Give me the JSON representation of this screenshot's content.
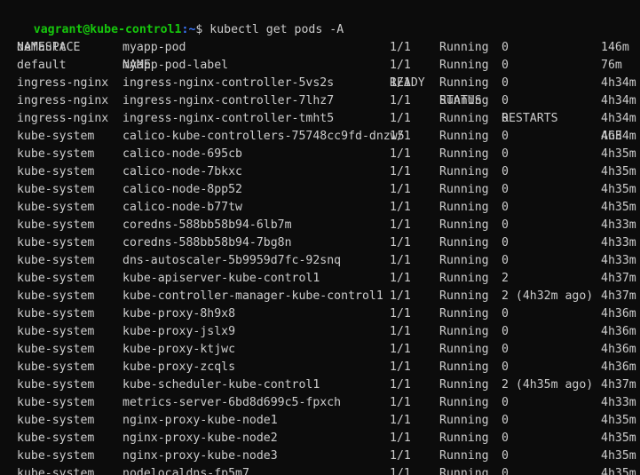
{
  "window": {
    "partial_line": "",
    "prompt_user_host": "vagrant@kube-control1",
    "prompt_path": ":~",
    "prompt_symbol": "$ ",
    "command": "kubectl get pods -A"
  },
  "table": {
    "headers": {
      "namespace": "NAMESPACE",
      "name": "NAME",
      "ready": "READY",
      "status": "STATUS",
      "restarts": "RESTARTS",
      "age": "AGE"
    },
    "rows": [
      {
        "namespace": "default",
        "name": "myapp-pod",
        "ready": "1/1",
        "status": "Running",
        "restarts": "0",
        "age": "146m"
      },
      {
        "namespace": "default",
        "name": "myapp-pod-label",
        "ready": "1/1",
        "status": "Running",
        "restarts": "0",
        "age": "76m"
      },
      {
        "namespace": "ingress-nginx",
        "name": "ingress-nginx-controller-5vs2s",
        "ready": "1/1",
        "status": "Running",
        "restarts": "0",
        "age": "4h34m"
      },
      {
        "namespace": "ingress-nginx",
        "name": "ingress-nginx-controller-7lhz7",
        "ready": "1/1",
        "status": "Running",
        "restarts": "0",
        "age": "4h34m"
      },
      {
        "namespace": "ingress-nginx",
        "name": "ingress-nginx-controller-tmht5",
        "ready": "1/1",
        "status": "Running",
        "restarts": "0",
        "age": "4h34m"
      },
      {
        "namespace": "kube-system",
        "name": "calico-kube-controllers-75748cc9fd-dnzw5",
        "ready": "1/1",
        "status": "Running",
        "restarts": "0",
        "age": "4h34m"
      },
      {
        "namespace": "kube-system",
        "name": "calico-node-695cb",
        "ready": "1/1",
        "status": "Running",
        "restarts": "0",
        "age": "4h35m"
      },
      {
        "namespace": "kube-system",
        "name": "calico-node-7bkxc",
        "ready": "1/1",
        "status": "Running",
        "restarts": "0",
        "age": "4h35m"
      },
      {
        "namespace": "kube-system",
        "name": "calico-node-8pp52",
        "ready": "1/1",
        "status": "Running",
        "restarts": "0",
        "age": "4h35m"
      },
      {
        "namespace": "kube-system",
        "name": "calico-node-b77tw",
        "ready": "1/1",
        "status": "Running",
        "restarts": "0",
        "age": "4h35m"
      },
      {
        "namespace": "kube-system",
        "name": "coredns-588bb58b94-6lb7m",
        "ready": "1/1",
        "status": "Running",
        "restarts": "0",
        "age": "4h33m"
      },
      {
        "namespace": "kube-system",
        "name": "coredns-588bb58b94-7bg8n",
        "ready": "1/1",
        "status": "Running",
        "restarts": "0",
        "age": "4h33m"
      },
      {
        "namespace": "kube-system",
        "name": "dns-autoscaler-5b9959d7fc-92snq",
        "ready": "1/1",
        "status": "Running",
        "restarts": "0",
        "age": "4h33m"
      },
      {
        "namespace": "kube-system",
        "name": "kube-apiserver-kube-control1",
        "ready": "1/1",
        "status": "Running",
        "restarts": "2",
        "age": "4h37m"
      },
      {
        "namespace": "kube-system",
        "name": "kube-controller-manager-kube-control1",
        "ready": "1/1",
        "status": "Running",
        "restarts": "2 (4h32m ago)",
        "age": "4h37m"
      },
      {
        "namespace": "kube-system",
        "name": "kube-proxy-8h9x8",
        "ready": "1/1",
        "status": "Running",
        "restarts": "0",
        "age": "4h36m"
      },
      {
        "namespace": "kube-system",
        "name": "kube-proxy-jslx9",
        "ready": "1/1",
        "status": "Running",
        "restarts": "0",
        "age": "4h36m"
      },
      {
        "namespace": "kube-system",
        "name": "kube-proxy-ktjwc",
        "ready": "1/1",
        "status": "Running",
        "restarts": "0",
        "age": "4h36m"
      },
      {
        "namespace": "kube-system",
        "name": "kube-proxy-zcqls",
        "ready": "1/1",
        "status": "Running",
        "restarts": "0",
        "age": "4h36m"
      },
      {
        "namespace": "kube-system",
        "name": "kube-scheduler-kube-control1",
        "ready": "1/1",
        "status": "Running",
        "restarts": "2 (4h35m ago)",
        "age": "4h37m"
      },
      {
        "namespace": "kube-system",
        "name": "metrics-server-6bd8d699c5-fpxch",
        "ready": "1/1",
        "status": "Running",
        "restarts": "0",
        "age": "4h33m"
      },
      {
        "namespace": "kube-system",
        "name": "nginx-proxy-kube-node1",
        "ready": "1/1",
        "status": "Running",
        "restarts": "0",
        "age": "4h35m"
      },
      {
        "namespace": "kube-system",
        "name": "nginx-proxy-kube-node2",
        "ready": "1/1",
        "status": "Running",
        "restarts": "0",
        "age": "4h35m"
      },
      {
        "namespace": "kube-system",
        "name": "nginx-proxy-kube-node3",
        "ready": "1/1",
        "status": "Running",
        "restarts": "0",
        "age": "4h35m"
      },
      {
        "namespace": "kube-system",
        "name": "nodelocaldns-fp5m7",
        "ready": "1/1",
        "status": "Running",
        "restarts": "0",
        "age": "4h35m"
      }
    ]
  },
  "colors": {
    "background": "#0c0c0c",
    "text": "#cccccc",
    "prompt_user": "#16c60c",
    "prompt_path": "#3b78ff"
  }
}
